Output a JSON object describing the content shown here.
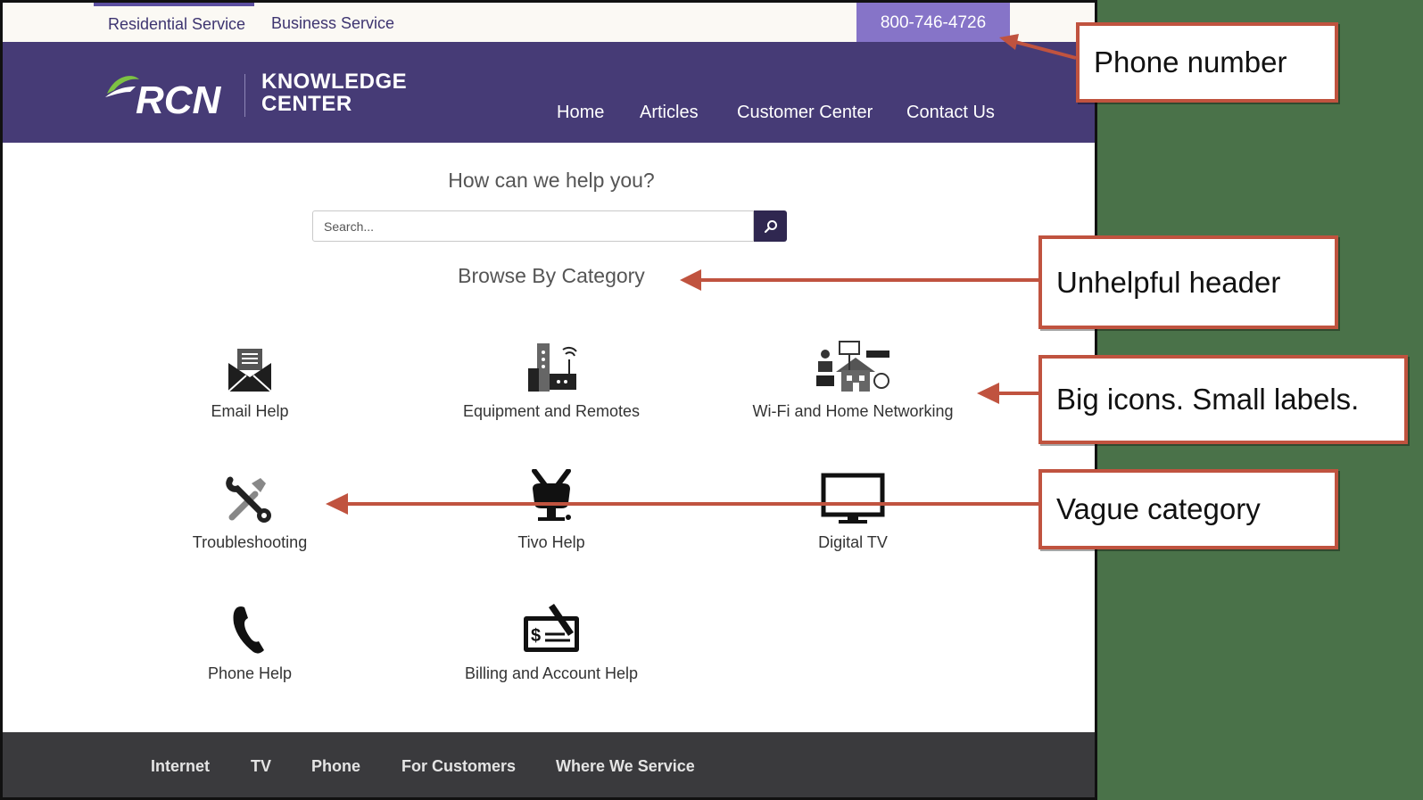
{
  "utility": {
    "tabs": [
      {
        "label": "Residential Service",
        "active": true
      },
      {
        "label": "Business Service",
        "active": false
      }
    ],
    "phone": "800-746-4726"
  },
  "header": {
    "logo_text": "RCN",
    "logo_subtitle_line1": "KNOWLEDGE",
    "logo_subtitle_line2": "CENTER",
    "nav": [
      "Home",
      "Articles",
      "Customer Center",
      "Contact Us"
    ]
  },
  "main": {
    "help_title": "How can we help you?",
    "search_placeholder": "Search...",
    "browse_title": "Browse By Category",
    "categories": [
      {
        "label": "Email Help",
        "icon": "envelope-icon"
      },
      {
        "label": "Equipment and Remotes",
        "icon": "router-icon"
      },
      {
        "label": "Wi-Fi and Home Networking",
        "icon": "home-network-icon"
      },
      {
        "label": "Troubleshooting",
        "icon": "tools-icon"
      },
      {
        "label": "Tivo Help",
        "icon": "tivo-icon"
      },
      {
        "label": "Digital TV",
        "icon": "monitor-icon"
      },
      {
        "label": "Phone Help",
        "icon": "phone-icon"
      },
      {
        "label": "Billing and Account Help",
        "icon": "check-icon"
      }
    ]
  },
  "footer": {
    "links": [
      "Internet",
      "TV",
      "Phone",
      "For Customers",
      "Where We Service"
    ]
  },
  "annotations": {
    "phone_number": "Phone number",
    "unhelpful_header": "Unhelpful header",
    "big_icons": "Big icons. Small labels.",
    "vague_category": "Vague category"
  },
  "colors": {
    "header_purple": "#463b76",
    "phone_tab": "#8674c8",
    "footer": "#3a3a3d",
    "annotation_red": "#c0533f",
    "background_green": "#4a7249"
  }
}
